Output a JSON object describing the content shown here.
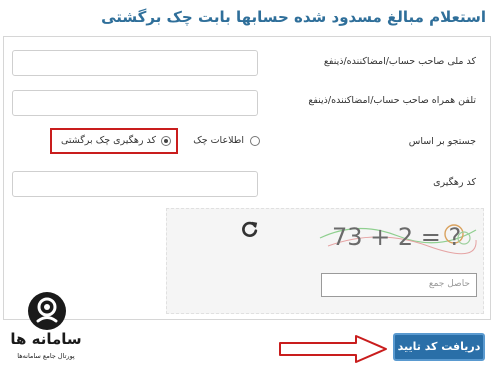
{
  "page": {
    "title": "استعلام مبالغ مسدود شده حسابها بابت چک برگشتی"
  },
  "form": {
    "national_id_label": "کد ملی صاحب حساب/امضاکننده/ذینفع",
    "mobile_label": "تلفن همراه صاحب حساب/امضاکننده/ذینفع",
    "search_basis_label": "جستجو بر اساس",
    "option_check_info": "اطلاعات چک",
    "option_tracking_code": "کد رهگیری چک برگشتی",
    "tracking_code_label": "کد رهگیری",
    "captcha_placeholder": "حاصل جمع",
    "captcha_text": "73 + 2 = ?",
    "submit_label": "دریافت کد تایید"
  },
  "logo": {
    "name": "سامانه ها",
    "tagline": "پورتال جامع سامانه‌ها"
  },
  "colors": {
    "title": "#2f6f9a",
    "button": "#2a6fa8",
    "highlight": "#c91d1d"
  }
}
